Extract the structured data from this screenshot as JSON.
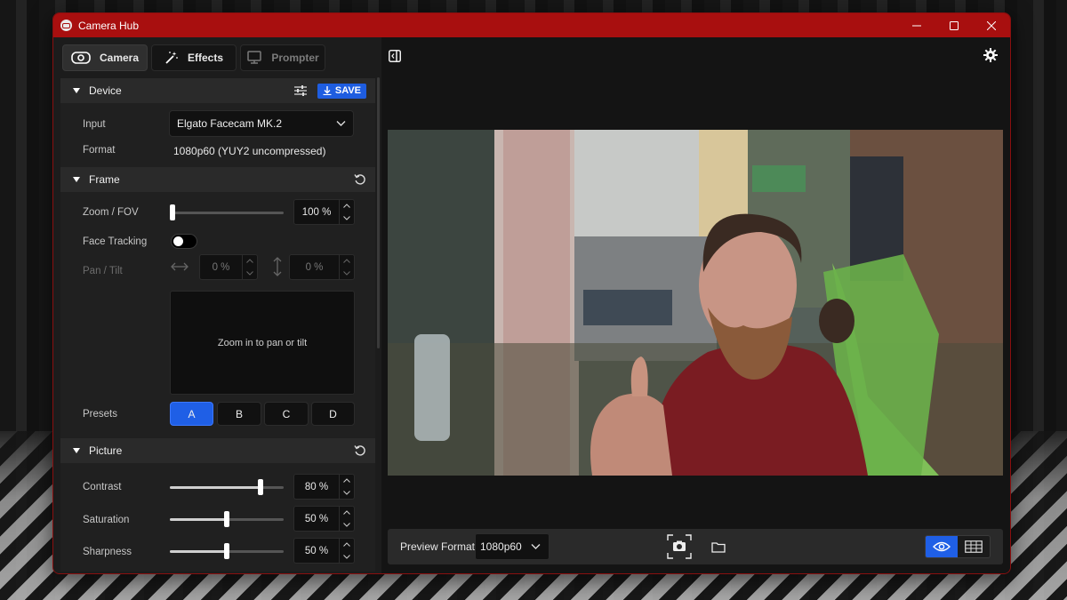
{
  "window": {
    "title": "Camera Hub"
  },
  "tabs": [
    {
      "label": "Camera",
      "icon": "camera-icon",
      "state": "active"
    },
    {
      "label": "Effects",
      "icon": "magic-wand-icon",
      "state": "normal"
    },
    {
      "label": "Prompter",
      "icon": "prompter-icon",
      "state": "disabled"
    }
  ],
  "device": {
    "title": "Device",
    "save_label": "SAVE",
    "input_label": "Input",
    "input_value": "Elgato Facecam MK.2",
    "format_label": "Format",
    "format_value": "1080p60 (YUY2 uncompressed)"
  },
  "frame": {
    "title": "Frame",
    "zoom_label": "Zoom / FOV",
    "zoom_value": "100 %",
    "zoom_level": 0.0,
    "face_tracking_label": "Face Tracking",
    "face_tracking_on": false,
    "pan_tilt_label": "Pan / Tilt",
    "pan_value": "0 %",
    "tilt_value": "0 %",
    "pan_area_text": "Zoom in to pan or tilt",
    "presets_label": "Presets",
    "presets": [
      "A",
      "B",
      "C",
      "D"
    ],
    "active_preset": "A"
  },
  "picture": {
    "title": "Picture",
    "contrast_label": "Contrast",
    "contrast_value": "80 %",
    "contrast_level": 0.8,
    "saturation_label": "Saturation",
    "saturation_value": "50 %",
    "saturation_level": 0.5,
    "sharpness_label": "Sharpness",
    "sharpness_value": "50 %",
    "sharpness_level": 0.5
  },
  "bottom": {
    "preview_format_label": "Preview Format",
    "preview_format_value": "1080p60"
  },
  "colors": {
    "titlebar": "#a80f0f",
    "accent": "#1f5fe6"
  }
}
